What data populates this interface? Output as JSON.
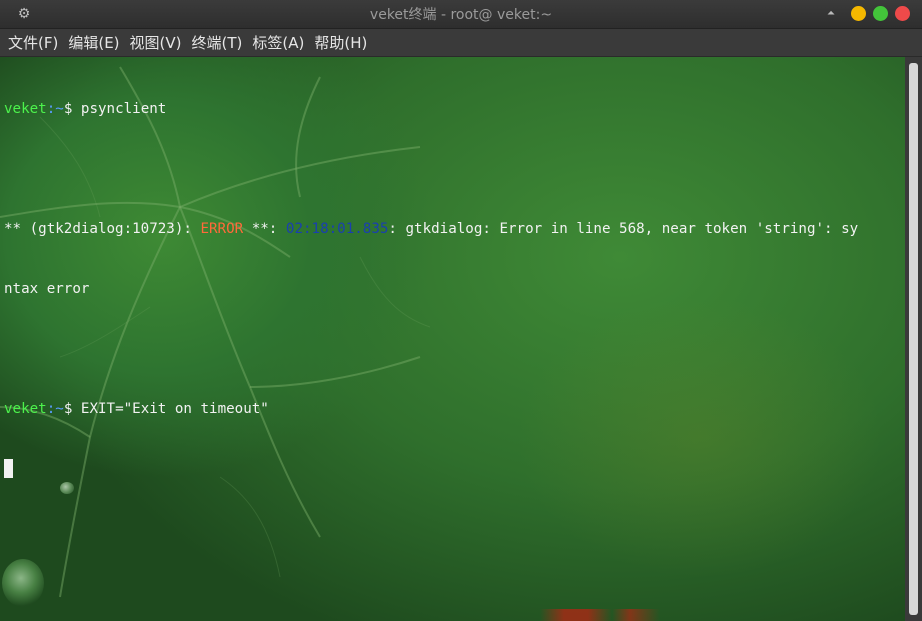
{
  "window": {
    "title": "veket终端 - root@ veket:~"
  },
  "menubar": {
    "items": [
      {
        "label": "文件(F)"
      },
      {
        "label": "编辑(E)"
      },
      {
        "label": "视图(V)"
      },
      {
        "label": "终端(T)"
      },
      {
        "label": "标签(A)"
      },
      {
        "label": "帮助(H)"
      }
    ]
  },
  "terminal": {
    "prompt_host": "veket",
    "prompt_path": ":~",
    "prompt_symbol": "$",
    "line1_command": " psynclient",
    "line2_prefix": "** (gtk2dialog:10723): ",
    "line2_error": "ERROR",
    "line2_mid": " **: ",
    "line2_time": "02:18:01.835",
    "line2_rest": ": gtkdialog: Error in line 568, near token 'string': sy",
    "line3": "ntax error",
    "line5_command": " EXIT=\"Exit on timeout\""
  },
  "colors": {
    "prompt_host": "#4cf24c",
    "prompt_path": "#5a9cff",
    "error": "#ff6a3a",
    "timestamp": "#1a3fb0"
  },
  "icons": {
    "title_left": "gear-icon",
    "title_up": "eject-icon"
  }
}
